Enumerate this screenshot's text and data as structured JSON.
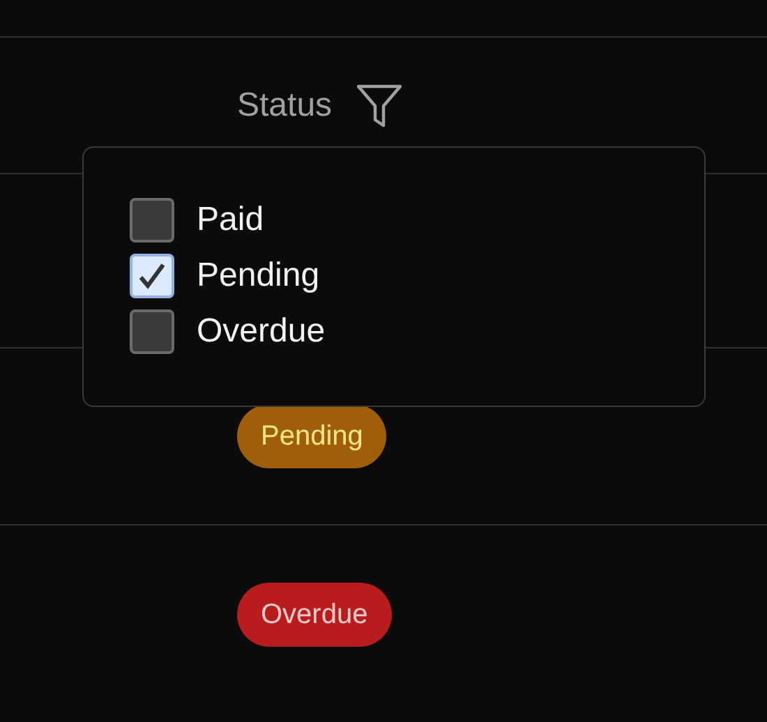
{
  "header": {
    "label": "Status"
  },
  "filter_menu": {
    "options": [
      {
        "label": "Paid",
        "checked": false
      },
      {
        "label": "Pending",
        "checked": true
      },
      {
        "label": "Overdue",
        "checked": false
      }
    ]
  },
  "rows": [
    {
      "status": {
        "label": "Pending",
        "kind": "pending"
      }
    },
    {
      "status": {
        "label": "Overdue",
        "kind": "overdue"
      }
    }
  ]
}
